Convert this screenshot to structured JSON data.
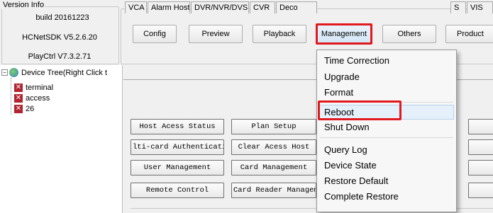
{
  "version_info": {
    "legend": "Version Info",
    "build": "build 20161223",
    "sdk": "HCNetSDK V5.2.6.20",
    "playctrl": "PlayCtrl V7.3.2.71"
  },
  "top_buttons": {
    "config": "Config",
    "preview": "Preview",
    "playback": "Playback",
    "management": "Management",
    "others": "Others",
    "product": "Product"
  },
  "tree": {
    "root": "Device Tree(Right Click t",
    "items": [
      "terminal",
      "access",
      "26"
    ]
  },
  "tabs": [
    "VCA",
    "Alarm Host",
    "DVR/NVR/DVS",
    "CVR",
    "Deco",
    "S",
    "VIS"
  ],
  "grid_buttons": {
    "host_access_status": "Host Acess Status",
    "plan_setup": "Plan Setup",
    "multi_card_auth": "lti-card Authenticati",
    "clear_access_host": "Clear Acess Host",
    "user_management": "User Management",
    "card_management": "Card Management",
    "remote_control": "Remote Control",
    "card_reader_management": "Card Reader Managem"
  },
  "management_menu": {
    "items": [
      "Time Correction",
      "Upgrade",
      "Format",
      "Reboot",
      "Shut Down",
      "Query Log",
      "Device State",
      "Restore Default",
      "Complete Restore"
    ],
    "hovered": "Reboot"
  },
  "colors": {
    "highlight_red": "#e0191e",
    "hover_blue": "#e5f0fb"
  }
}
